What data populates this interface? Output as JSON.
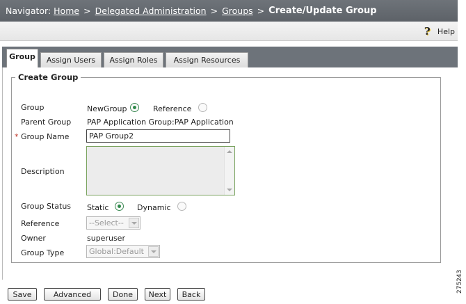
{
  "navigator": {
    "prefix": "Navigator:",
    "crumbs": [
      "Home",
      "Delegated Administration",
      "Groups"
    ],
    "separator": ">",
    "current": "Create/Update Group"
  },
  "help": {
    "label": "Help",
    "icon": "question-mark-icon"
  },
  "tabs": [
    "Group",
    "Assign Users",
    "Assign Roles",
    "Assign Resources"
  ],
  "active_tab": "Group",
  "form": {
    "legend": "Create Group",
    "group_label": "Group",
    "group_options": [
      "NewGroup",
      "Reference"
    ],
    "group_selected": "NewGroup",
    "parent_group_label": "Parent Group",
    "parent_group_value": "PAP Application Group:PAP Application",
    "required_marker": "*",
    "group_name_label": "Group Name",
    "group_name_value": "PAP Group2",
    "description_label": "Description",
    "description_value": "",
    "group_status_label": "Group Status",
    "status_options": [
      "Static",
      "Dynamic"
    ],
    "status_selected": "Static",
    "reference_label": "Reference",
    "reference_value": "--Select--",
    "owner_label": "Owner",
    "owner_value": "superuser",
    "group_type_label": "Group Type",
    "group_type_value": "Global:Default"
  },
  "buttons": [
    "Save",
    "Advanced",
    "Done",
    "Next",
    "Back"
  ],
  "figure_id": "275243",
  "colors": {
    "header_bg": "#666b71",
    "tab_strip_bg": "#6d737a",
    "radio_selected": "#2f8a4a",
    "required": "#c0392b"
  }
}
